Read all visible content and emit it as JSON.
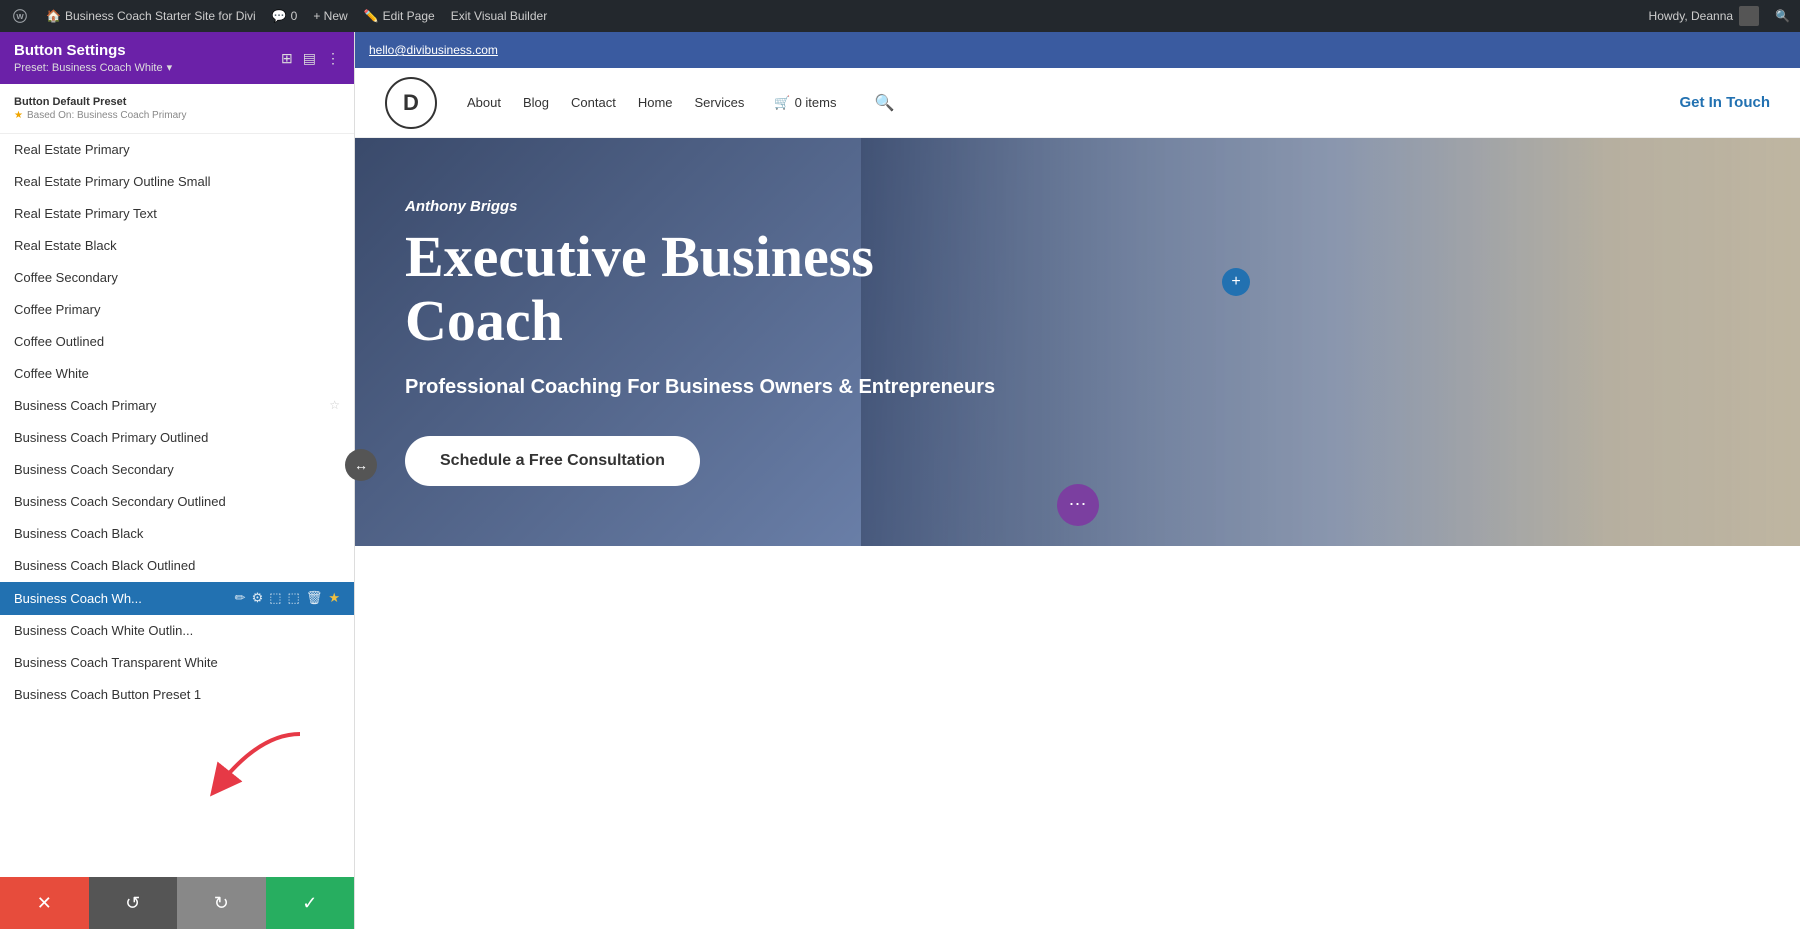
{
  "admin_bar": {
    "wp_label": "WordPress",
    "site_name": "Business Coach Starter Site for Divi",
    "comments": "0",
    "new_label": "+ New",
    "edit_page": "Edit Page",
    "exit_builder": "Exit Visual Builder",
    "howdy": "Howdy, Deanna",
    "search_icon": "🔍"
  },
  "site_nav_bar": {
    "email": "hello@divibusiness.com"
  },
  "left_panel": {
    "title": "Button Settings",
    "preset_label": "Preset: Business Coach White",
    "section_title": "Button Default Preset",
    "based_on": "Based On: Business Coach Primary",
    "presets": [
      {
        "id": 1,
        "label": "Real Estate Primary"
      },
      {
        "id": 2,
        "label": "Real Estate Primary Outline Small"
      },
      {
        "id": 3,
        "label": "Real Estate Primary Text"
      },
      {
        "id": 4,
        "label": "Real Estate Black"
      },
      {
        "id": 5,
        "label": "Coffee Secondary"
      },
      {
        "id": 6,
        "label": "Coffee Primary"
      },
      {
        "id": 7,
        "label": "Coffee Outlined"
      },
      {
        "id": 8,
        "label": "Coffee White"
      },
      {
        "id": 9,
        "label": "Business Coach Primary"
      },
      {
        "id": 10,
        "label": "Business Coach Primary Outlined"
      },
      {
        "id": 11,
        "label": "Business Coach Secondary"
      },
      {
        "id": 12,
        "label": "Business Coach Secondary Outlined"
      },
      {
        "id": 13,
        "label": "Business Coach Black"
      },
      {
        "id": 14,
        "label": "Business Coach Black Outlined"
      },
      {
        "id": 15,
        "label": "Business Coach Wh...",
        "active": true
      },
      {
        "id": 16,
        "label": "Business Coach White Outlin..."
      },
      {
        "id": 17,
        "label": "Business Coach Transparent White"
      },
      {
        "id": 18,
        "label": "Business Coach Button Preset 1"
      }
    ],
    "active_preset_actions": [
      "✏",
      "⚙",
      "⬚",
      "⬚",
      "🗑",
      "★"
    ],
    "bottom_buttons": [
      {
        "id": "cancel",
        "icon": "✕",
        "color": "red"
      },
      {
        "id": "undo",
        "icon": "↺",
        "color": "gray"
      },
      {
        "id": "redo",
        "icon": "↻",
        "color": "light-gray"
      },
      {
        "id": "save",
        "icon": "✓",
        "color": "green"
      }
    ]
  },
  "site_header": {
    "logo": "D",
    "nav_items": [
      "About",
      "Blog",
      "Contact",
      "Home",
      "Services"
    ],
    "cart": "0 items",
    "cta": "Get In Touch"
  },
  "hero": {
    "name": "Anthony Briggs",
    "title": "Executive Business Coach",
    "subtitle": "Professional Coaching For Business Owners & Entrepreneurs",
    "cta_button": "Schedule a Free Consultation"
  }
}
